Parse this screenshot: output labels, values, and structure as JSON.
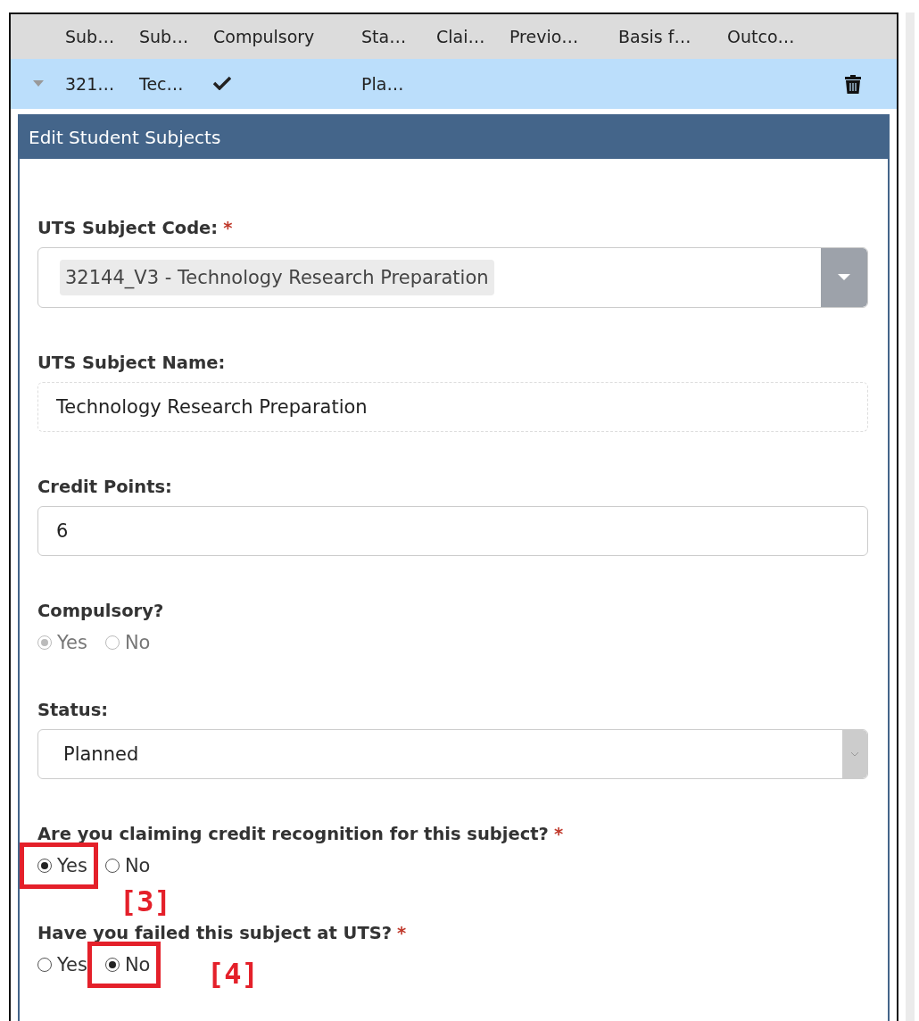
{
  "grid": {
    "columns": [
      "Sub…",
      "Sub…",
      "Compulsory",
      "Sta…",
      "Clai…",
      "Previo…",
      "Basis f…",
      "Outco…"
    ],
    "row": {
      "selected": true,
      "expanded": true,
      "cells": [
        "321…",
        "Tec…",
        "",
        "Pla…",
        "",
        "",
        "",
        ""
      ],
      "compulsory_checked": true
    }
  },
  "panel": {
    "title": "Edit Student Subjects",
    "fields": [
      {
        "kind": "combo",
        "label": "UTS Subject Code:",
        "required_mark": "*",
        "value": "32144_V3 - Technology Research Preparation"
      },
      {
        "kind": "readonly",
        "label": "UTS Subject Name:",
        "value": "Technology Research Preparation"
      },
      {
        "kind": "text",
        "label": "Credit Points:",
        "value": "6"
      },
      {
        "kind": "radio",
        "label": "Compulsory?",
        "disabled": true,
        "options": [
          {
            "label": "Yes",
            "selected": true,
            "highlighted": false
          },
          {
            "label": "No",
            "selected": false,
            "highlighted": false
          }
        ]
      },
      {
        "kind": "select",
        "label": "Status:",
        "value": "Planned"
      },
      {
        "kind": "radio",
        "label": "Are you claiming credit recognition for this subject?",
        "required_mark": "*",
        "callout": "[3]",
        "options": [
          {
            "label": "Yes",
            "selected": true,
            "highlighted": true
          },
          {
            "label": "No",
            "selected": false,
            "highlighted": false
          }
        ]
      },
      {
        "kind": "radio",
        "label": "Have you failed this subject at UTS?",
        "required_mark": "*",
        "callout": "[4]",
        "options": [
          {
            "label": "Yes",
            "selected": false,
            "highlighted": false
          },
          {
            "label": "No",
            "selected": true,
            "highlighted": true
          }
        ]
      }
    ]
  }
}
